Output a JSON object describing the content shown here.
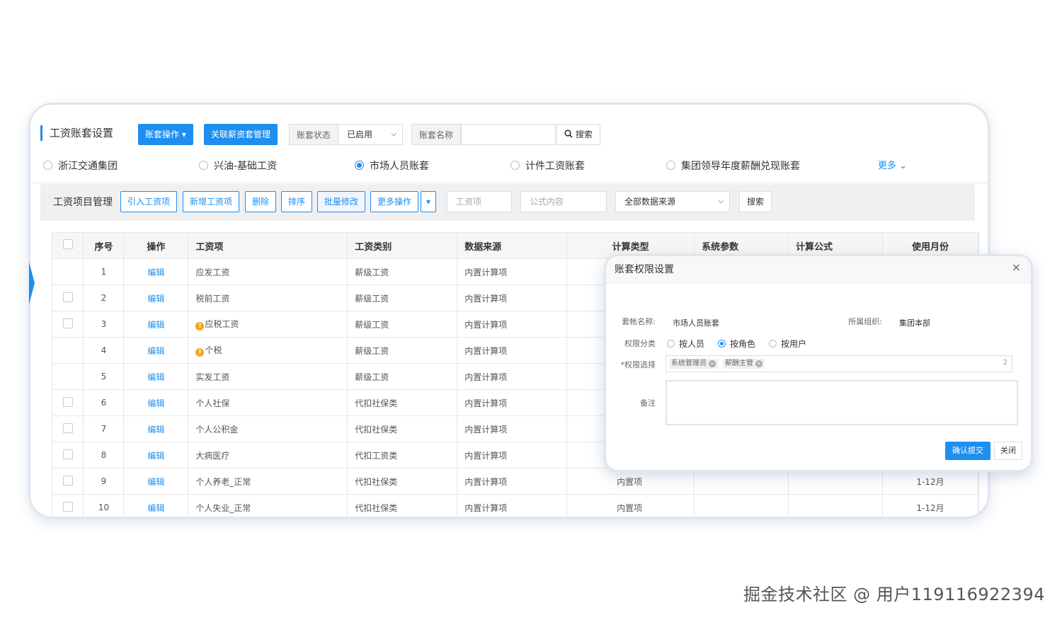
{
  "header": {
    "title": "工资账套设置",
    "ops_button": "账套操作 ▾",
    "link_button": "关联薪资套管理",
    "status_label": "账套状态",
    "status_value": "已启用",
    "name_label": "账套名称",
    "name_value": "",
    "search_button": "搜索"
  },
  "accounts": {
    "items": [
      "浙江交通集团",
      "兴油-基础工资",
      "市场人员账套",
      "计件工资账套",
      "集团领导年度薪酬兑现账套"
    ],
    "selected_index": 2,
    "more_link": "更多 ⌄"
  },
  "toolbar": {
    "title": "工资项目管理",
    "import": "引入工资项",
    "add": "新增工资项",
    "delete": "删除",
    "sort": "排序",
    "batch_edit": "批量修改",
    "more_ops": "更多操作",
    "more_caret": "▾",
    "item_placeholder": "工资项",
    "formula_placeholder": "公式内容",
    "source_select": "全部数据来源",
    "search": "搜索"
  },
  "table": {
    "headers": [
      "",
      "序号",
      "操作",
      "工资项",
      "工资类别",
      "数据来源",
      "计算类型",
      "系统参数",
      "计算公式",
      "使用月份"
    ],
    "rows": [
      {
        "no": "1",
        "op": "编辑",
        "item": "应发工资",
        "warn": false,
        "category": "薪级工资",
        "source": "内置计算项",
        "calc": "",
        "param": "",
        "formula": "",
        "months": "",
        "checkbox": false
      },
      {
        "no": "2",
        "op": "编辑",
        "item": "税前工资",
        "warn": false,
        "category": "薪级工资",
        "source": "内置计算项",
        "calc": "",
        "param": "",
        "formula": "",
        "months": "",
        "checkbox": true
      },
      {
        "no": "3",
        "op": "编辑",
        "item": "应税工资",
        "warn": true,
        "category": "薪级工资",
        "source": "内置计算项",
        "calc": "",
        "param": "",
        "formula": "",
        "months": "",
        "checkbox": true
      },
      {
        "no": "4",
        "op": "编辑",
        "item": "个税",
        "warn": true,
        "category": "薪级工资",
        "source": "内置计算项",
        "calc": "",
        "param": "",
        "formula": "",
        "months": "",
        "checkbox": false
      },
      {
        "no": "5",
        "op": "编辑",
        "item": "实发工资",
        "warn": false,
        "category": "薪级工资",
        "source": "内置计算项",
        "calc": "",
        "param": "",
        "formula": "",
        "months": "",
        "checkbox": false
      },
      {
        "no": "6",
        "op": "编辑",
        "item": "个人社保",
        "warn": false,
        "category": "代扣社保类",
        "source": "内置计算项",
        "calc": "",
        "param": "",
        "formula": "",
        "months": "",
        "checkbox": true
      },
      {
        "no": "7",
        "op": "编辑",
        "item": "个人公积金",
        "warn": false,
        "category": "代扣社保类",
        "source": "内置计算项",
        "calc": "",
        "param": "",
        "formula": "",
        "months": "",
        "checkbox": true
      },
      {
        "no": "8",
        "op": "编辑",
        "item": "大病医疗",
        "warn": false,
        "category": "代扣工资类",
        "source": "内置计算项",
        "calc": "",
        "param": "",
        "formula": "",
        "months": "",
        "checkbox": true
      },
      {
        "no": "9",
        "op": "编辑",
        "item": "个人养老_正常",
        "warn": false,
        "category": "代扣社保类",
        "source": "内置计算项",
        "calc": "内置项",
        "param": "",
        "formula": "",
        "months": "1-12月",
        "checkbox": true
      },
      {
        "no": "10",
        "op": "编辑",
        "item": "个人失业_正常",
        "warn": false,
        "category": "代扣社保类",
        "source": "内置计算项",
        "calc": "内置项",
        "param": "",
        "formula": "",
        "months": "1-12月",
        "checkbox": true
      }
    ]
  },
  "modal": {
    "title": "账套权限设置",
    "close": "×",
    "set_name_label": "套帐名称:",
    "set_name_value": "市场人员账套",
    "org_label": "所属组织:",
    "org_value": "集团本部",
    "perm_type_label": "权限分类",
    "perm_options": [
      "按人员",
      "按角色",
      "按用户"
    ],
    "perm_selected_index": 1,
    "perm_select_label": "*权限选择",
    "tags": [
      "系统管理员",
      "薪酬主管"
    ],
    "tag_remove": "×",
    "tag_count": "2",
    "note_label": "备注",
    "confirm": "确认提交",
    "cancel": "关闭"
  },
  "watermark": "掘金技术社区 @ 用户119116922394",
  "colors": {
    "accent": "#1e8ff0",
    "warning": "#f5a623"
  }
}
